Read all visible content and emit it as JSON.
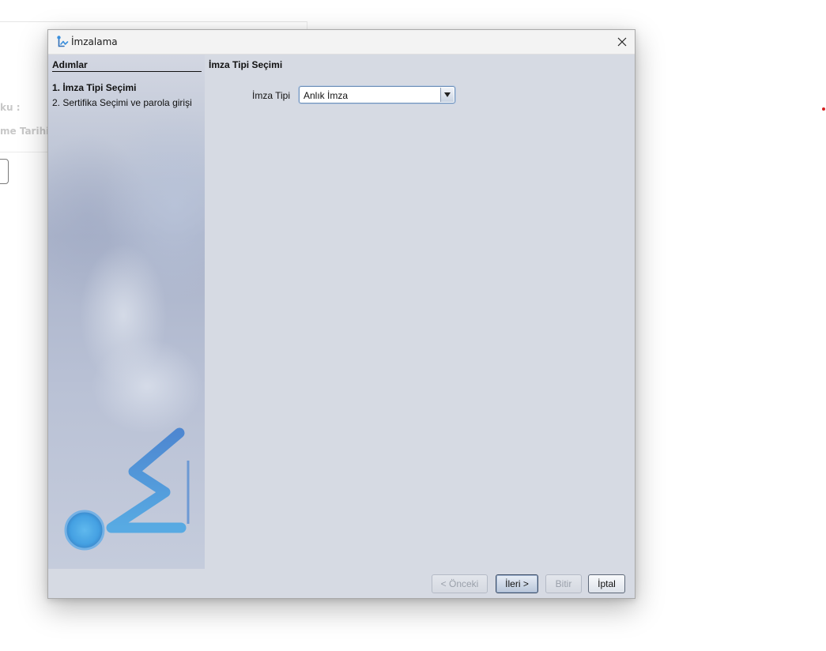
{
  "background_window": {
    "label_1": "ku :",
    "label_2": "me Tarihi :"
  },
  "dialog": {
    "title": "İmzalama",
    "icon": "signature-icon",
    "steps_panel": {
      "header": "Adımlar",
      "steps": [
        {
          "label": "1. İmza Tipi Seçimi",
          "active": true
        },
        {
          "label": "2. Sertifika Seçimi ve parola girişi",
          "active": false
        }
      ],
      "logo": "sigma-logo"
    },
    "content": {
      "title": "İmza Tipi Seçimi",
      "signature_type": {
        "label": "İmza Tipi",
        "selected": "Anlık İmza"
      }
    },
    "buttons": {
      "previous": {
        "label": "< Önceki",
        "enabled": false
      },
      "next": {
        "label": "İleri >",
        "enabled": true
      },
      "finish": {
        "label": "Bitir",
        "enabled": false
      },
      "cancel": {
        "label": "İptal",
        "enabled": true
      }
    }
  },
  "colors": {
    "dialog_background": "#d6dae3",
    "titlebar_background": "#f3f3f3",
    "logo_blue": "#4a8fd8",
    "logo_circle": "#3aa2e8"
  }
}
